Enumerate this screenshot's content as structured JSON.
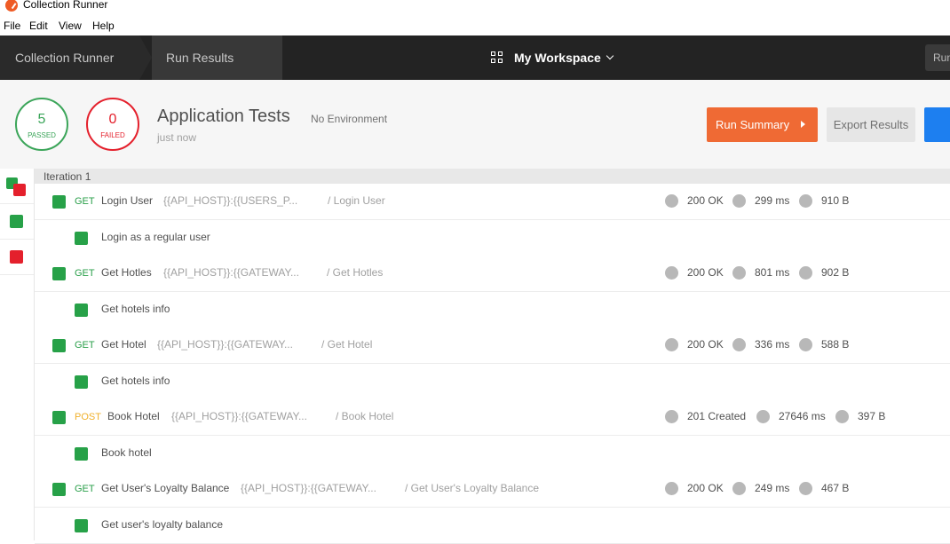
{
  "app": {
    "title": "Collection Runner"
  },
  "menu": [
    "File",
    "Edit",
    "View",
    "Help"
  ],
  "header": {
    "breadcrumb": [
      "Collection Runner",
      "Run Results"
    ],
    "workspace": "My Workspace",
    "run_label": "Run"
  },
  "summary": {
    "passed_count": "5",
    "passed_label": "PASSED",
    "failed_count": "0",
    "failed_label": "FAILED",
    "collection_name": "Application Tests",
    "environment": "No Environment",
    "time": "just now",
    "run_summary_label": "Run Summary",
    "export_label": "Export Results"
  },
  "colors": {
    "accent": "#ef6a34",
    "pass": "#27a148",
    "fail": "#e4202c",
    "primary": "#1d7ff0"
  },
  "iteration_label": "Iteration 1",
  "requests": [
    {
      "method": "GET",
      "name": "Login User",
      "url": "{{API_HOST}}:{{USERS_P...",
      "path": "/ Login User",
      "status": "200 OK",
      "time": "299 ms",
      "size": "910 B",
      "test": "Login as a regular user"
    },
    {
      "method": "GET",
      "name": "Get Hotles",
      "url": "{{API_HOST}}:{{GATEWAY...",
      "path": "/ Get Hotles",
      "status": "200 OK",
      "time": "801 ms",
      "size": "902 B",
      "test": "Get hotels info"
    },
    {
      "method": "GET",
      "name": "Get Hotel",
      "url": "{{API_HOST}}:{{GATEWAY...",
      "path": "/ Get Hotel",
      "status": "200 OK",
      "time": "336 ms",
      "size": "588 B",
      "test": "Get hotels info"
    },
    {
      "method": "POST",
      "name": "Book Hotel",
      "url": "{{API_HOST}}:{{GATEWAY...",
      "path": "/ Book Hotel",
      "status": "201 Created",
      "time": "27646 ms",
      "size": "397 B",
      "test": "Book hotel"
    },
    {
      "method": "GET",
      "name": "Get User's Loyalty Balance",
      "url": "{{API_HOST}}:{{GATEWAY...",
      "path": "/ Get User's Loyalty Balance",
      "status": "200 OK",
      "time": "249 ms",
      "size": "467 B",
      "test": "Get user's loyalty balance"
    }
  ]
}
